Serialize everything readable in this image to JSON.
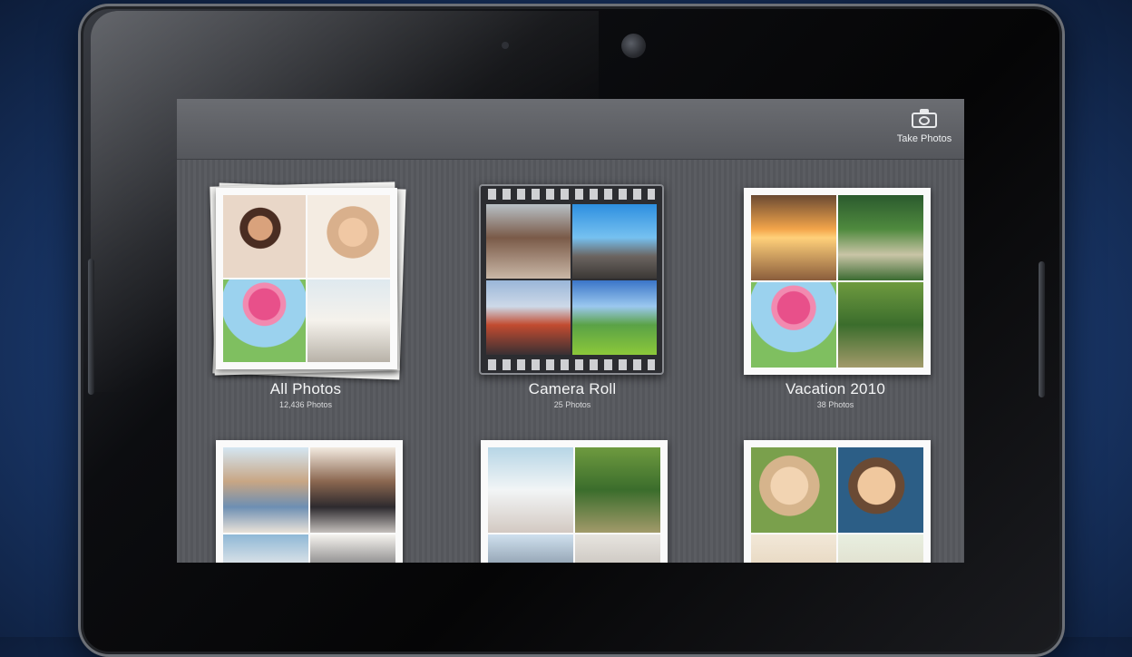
{
  "header": {
    "take_photos_label": "Take Photos",
    "take_photos_icon": "camera-icon"
  },
  "albums": [
    {
      "title": "All Photos",
      "count": "12,436 Photos"
    },
    {
      "title": "Camera Roll",
      "count": "25 Photos"
    },
    {
      "title": "Vacation 2010",
      "count": "38 Photos"
    },
    {
      "title": "",
      "count": ""
    },
    {
      "title": "",
      "count": ""
    },
    {
      "title": "",
      "count": ""
    }
  ],
  "colors": {
    "screen_bg": "#58595e",
    "label_text": "#f4f5f6"
  }
}
